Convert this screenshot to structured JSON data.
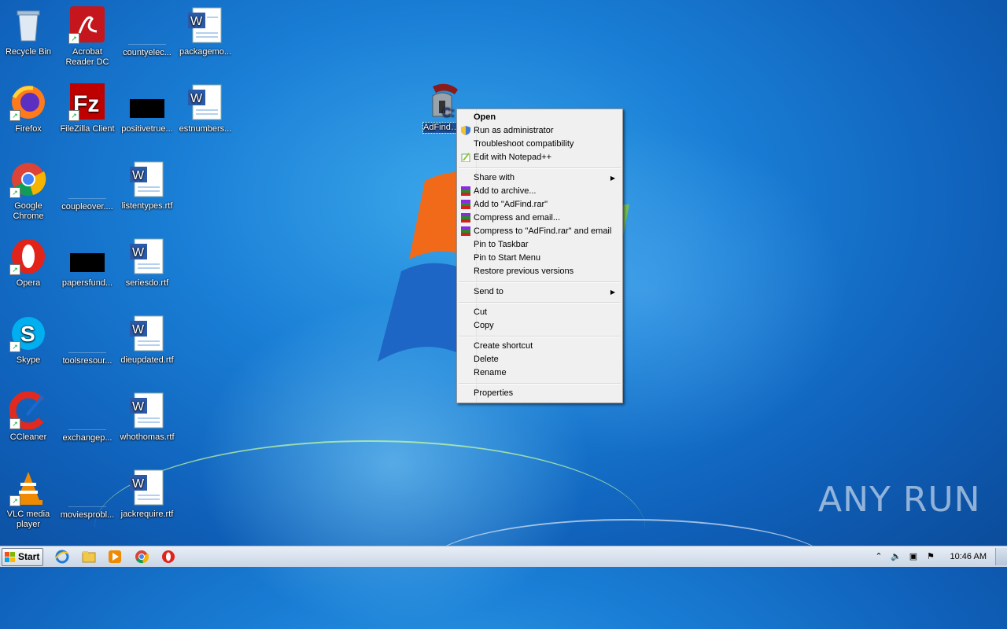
{
  "desktop": {
    "icons": [
      {
        "label": "Recycle Bin"
      },
      {
        "label": "Acrobat Reader DC"
      },
      {
        "label": "countyelec..."
      },
      {
        "label": "packagemo..."
      },
      {
        "label": "Firefox"
      },
      {
        "label": "FileZilla Client"
      },
      {
        "label": "positivetrue..."
      },
      {
        "label": "estnumbers..."
      },
      {
        "label": "Google Chrome"
      },
      {
        "label": "coupleover...."
      },
      {
        "label": "listentypes.rtf"
      },
      {
        "label": "Opera"
      },
      {
        "label": "papersfund..."
      },
      {
        "label": "seriesdo.rtf"
      },
      {
        "label": "Skype"
      },
      {
        "label": "toolsresour..."
      },
      {
        "label": "dieupdated.rtf"
      },
      {
        "label": "CCleaner"
      },
      {
        "label": "exchangep..."
      },
      {
        "label": "whothomas.rtf"
      },
      {
        "label": "VLC media player"
      },
      {
        "label": "moviesprobl..."
      },
      {
        "label": "jackrequire.rtf"
      },
      {
        "label": "AdFind.exe"
      }
    ]
  },
  "context_menu": {
    "items": [
      {
        "label": "Open"
      },
      {
        "label": "Run as administrator"
      },
      {
        "label": "Troubleshoot compatibility"
      },
      {
        "label": "Edit with Notepad++"
      },
      {
        "label": "Share with"
      },
      {
        "label": "Add to archive..."
      },
      {
        "label": "Add to \"AdFind.rar\""
      },
      {
        "label": "Compress and email..."
      },
      {
        "label": "Compress to \"AdFind.rar\" and email"
      },
      {
        "label": "Pin to Taskbar"
      },
      {
        "label": "Pin to Start Menu"
      },
      {
        "label": "Restore previous versions"
      },
      {
        "label": "Send to"
      },
      {
        "label": "Cut"
      },
      {
        "label": "Copy"
      },
      {
        "label": "Create shortcut"
      },
      {
        "label": "Delete"
      },
      {
        "label": "Rename"
      },
      {
        "label": "Properties"
      }
    ]
  },
  "taskbar": {
    "start_label": "Start",
    "clock": "10:46 AM",
    "pinned": [
      "internet-explorer-icon",
      "explorer-folder-icon",
      "media-player-icon",
      "chrome-icon",
      "opera-icon"
    ]
  },
  "watermark": "ANY RUN",
  "colors": {
    "accent": "#1b4f9c",
    "taskbar": "#dfe7f1",
    "menu_bg": "#f0f0f0"
  }
}
